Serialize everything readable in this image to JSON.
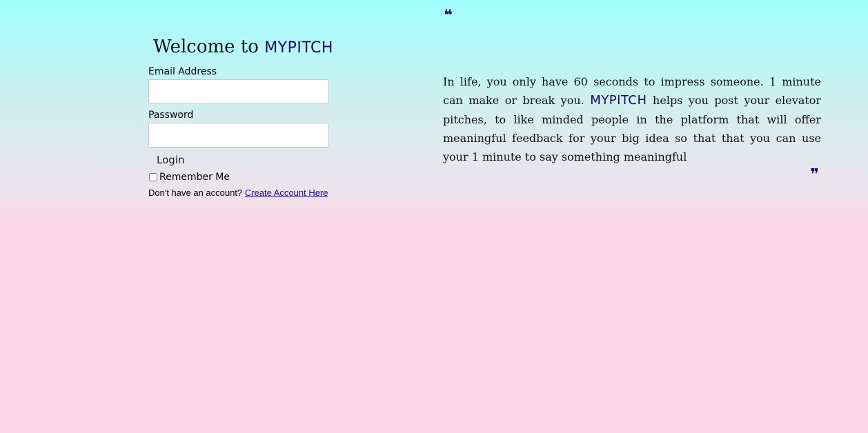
{
  "quote_icon": "quote-icon",
  "login": {
    "welcome_prefix": "Welcome to",
    "brand": "MYPITCH",
    "email_label": "Email Address",
    "email_value": "",
    "password_label": "Password",
    "password_value": "",
    "login_button": "Login",
    "remember_label": "Remember Me",
    "remember_checked": false,
    "signup_prompt": "Don't have an account?",
    "signup_link": "Create Account Here"
  },
  "about": {
    "text_before": "In life, you only have 60 seconds to impress someone. 1 minute can make or break you.",
    "brand": "MYPITCH",
    "text_after": "helps you post your elevator pitches, to like minded people in the platform that will offer meaningful feedback for your big idea so that that you can use your 1 minute to say something meaningful"
  },
  "colors": {
    "brand": "#1a0a5e",
    "link": "#1a0a8c",
    "bg_top": "#9ffffd",
    "bg_bottom": "#fdd8e8"
  }
}
